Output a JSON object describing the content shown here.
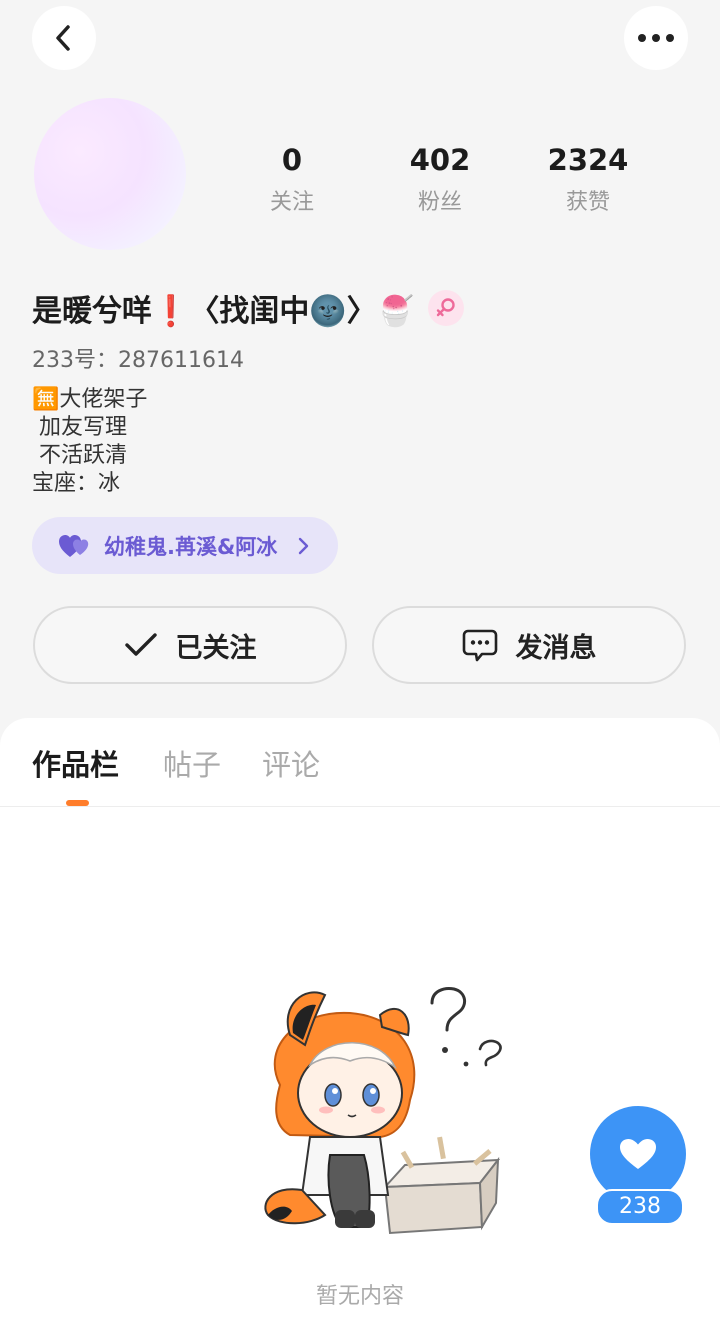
{
  "header": {
    "back_icon": "chevron-left-icon",
    "more_icon": "more-dots-icon"
  },
  "stats": [
    {
      "value": "0",
      "label": "关注"
    },
    {
      "value": "402",
      "label": "粉丝"
    },
    {
      "value": "2324",
      "label": "获赞"
    }
  ],
  "profile": {
    "name": "是暖兮咩❗〈找闺中🌚〉🍧",
    "gender_icon": "female-icon",
    "uid": "233号：287611614",
    "bio": [
      "🈚大佬架子",
      " 加友写理",
      " 不活跃清",
      "宝座：冰"
    ]
  },
  "group": {
    "label": "幼稚鬼.苒溪&阿冰",
    "icon": "hearts-icon"
  },
  "actions": {
    "follow_label": "已关注",
    "message_label": "发消息"
  },
  "tabs": [
    {
      "label": "作品栏",
      "active": true
    },
    {
      "label": "帖子",
      "active": false
    },
    {
      "label": "评论",
      "active": false
    }
  ],
  "like": {
    "count": "238"
  },
  "empty": {
    "text": "暂无内容"
  },
  "colors": {
    "accent_orange": "#ff7d2b",
    "like_blue": "#3d94f6",
    "group_purple": "#6b5bd3"
  }
}
